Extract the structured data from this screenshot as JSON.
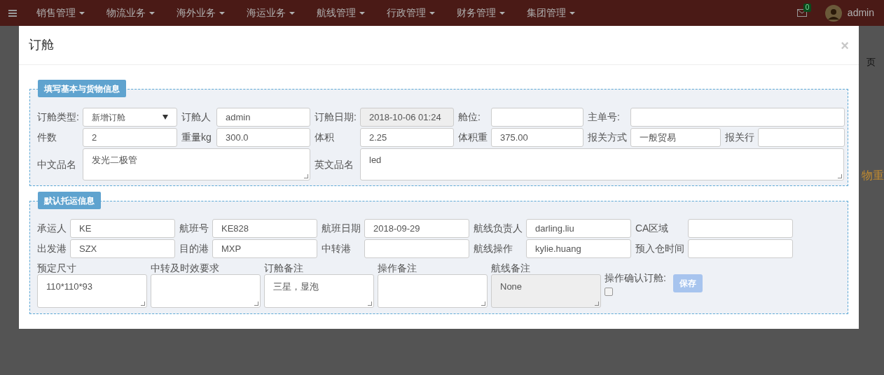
{
  "navbar": {
    "menu_items": [
      "销售管理",
      "物流业务",
      "海外业务",
      "海运业务",
      "航线管理",
      "行政管理",
      "财务管理",
      "集团管理"
    ],
    "notification_count": "0",
    "user": "admin"
  },
  "background": {
    "breadcrumb": "页",
    "side_text": "物重"
  },
  "modal": {
    "title": "订舱",
    "close": "×",
    "sections": [
      {
        "legend": "填写基本与货物信息",
        "rows": [
          [
            {
              "kind": "select",
              "label": "订舱类型:",
              "value": "新增订舱",
              "disabled": false
            },
            {
              "kind": "input",
              "label": "订舱人",
              "value": "admin",
              "disabled": false
            },
            {
              "kind": "input",
              "label": "订舱日期:",
              "value": "2018-10-06 01:24",
              "disabled": true
            },
            {
              "kind": "input",
              "label": "舱位:",
              "disabled": false
            },
            {
              "kind": "input",
              "label": "主单号:",
              "disabled": false
            }
          ],
          [
            {
              "kind": "input",
              "label": "件数",
              "value": "2",
              "disabled": false
            },
            {
              "kind": "input",
              "label": "重量kg",
              "value": "300.0",
              "disabled": false
            },
            {
              "kind": "input",
              "label": "体积",
              "value": "2.25",
              "disabled": false
            },
            {
              "kind": "input",
              "label": "体积重",
              "value": "375.00",
              "disabled": false
            },
            {
              "kind": "input",
              "label": "报关方式",
              "value": "一般贸易",
              "disabled": false
            },
            {
              "kind": "input",
              "label": "报关行",
              "disabled": false
            }
          ]
        ],
        "notes": [
          {
            "label": "中文品名",
            "value": "发光二极管",
            "disabled": false
          },
          {
            "label": "英文品名",
            "value": "led",
            "disabled": false
          }
        ]
      },
      {
        "legend": "默认托运信息",
        "rows": [
          [
            {
              "kind": "input",
              "label": "承运人",
              "value": "KE",
              "disabled": false
            },
            {
              "kind": "input",
              "label": "航班号",
              "value": "KE828",
              "disabled": false
            },
            {
              "kind": "input",
              "label": "航班日期",
              "value": "2018-09-29",
              "disabled": false
            },
            {
              "kind": "input",
              "label": "航线负责人",
              "value": "darling.liu",
              "disabled": false
            },
            {
              "kind": "input",
              "label": "CA区域",
              "disabled": false
            }
          ],
          [
            {
              "kind": "input",
              "label": "出发港",
              "value": "SZX",
              "disabled": false
            },
            {
              "kind": "input",
              "label": "目的港",
              "value": "MXP",
              "disabled": false
            },
            {
              "kind": "input",
              "label": "中转港",
              "disabled": false
            },
            {
              "kind": "input",
              "label": "航线操作",
              "value": "kylie.huang",
              "disabled": false
            },
            {
              "kind": "input",
              "label": "预入仓时间",
              "disabled": false
            }
          ]
        ],
        "remarks": [
          {
            "label": "预定尺寸",
            "value": "110*110*93",
            "disabled": false
          },
          {
            "label": "中转及时效要求",
            "disabled": false
          },
          {
            "label": "订舱备注",
            "value": "三星，显泡",
            "disabled": false
          },
          {
            "label": "操作备注",
            "disabled": false
          },
          {
            "label": "航线备注",
            "value": "None",
            "disabled": true
          }
        ],
        "confirm": {
          "label": "操作确认订舱:",
          "checked": false
        },
        "save": {
          "label": "保存",
          "disabled": true
        }
      }
    ]
  }
}
